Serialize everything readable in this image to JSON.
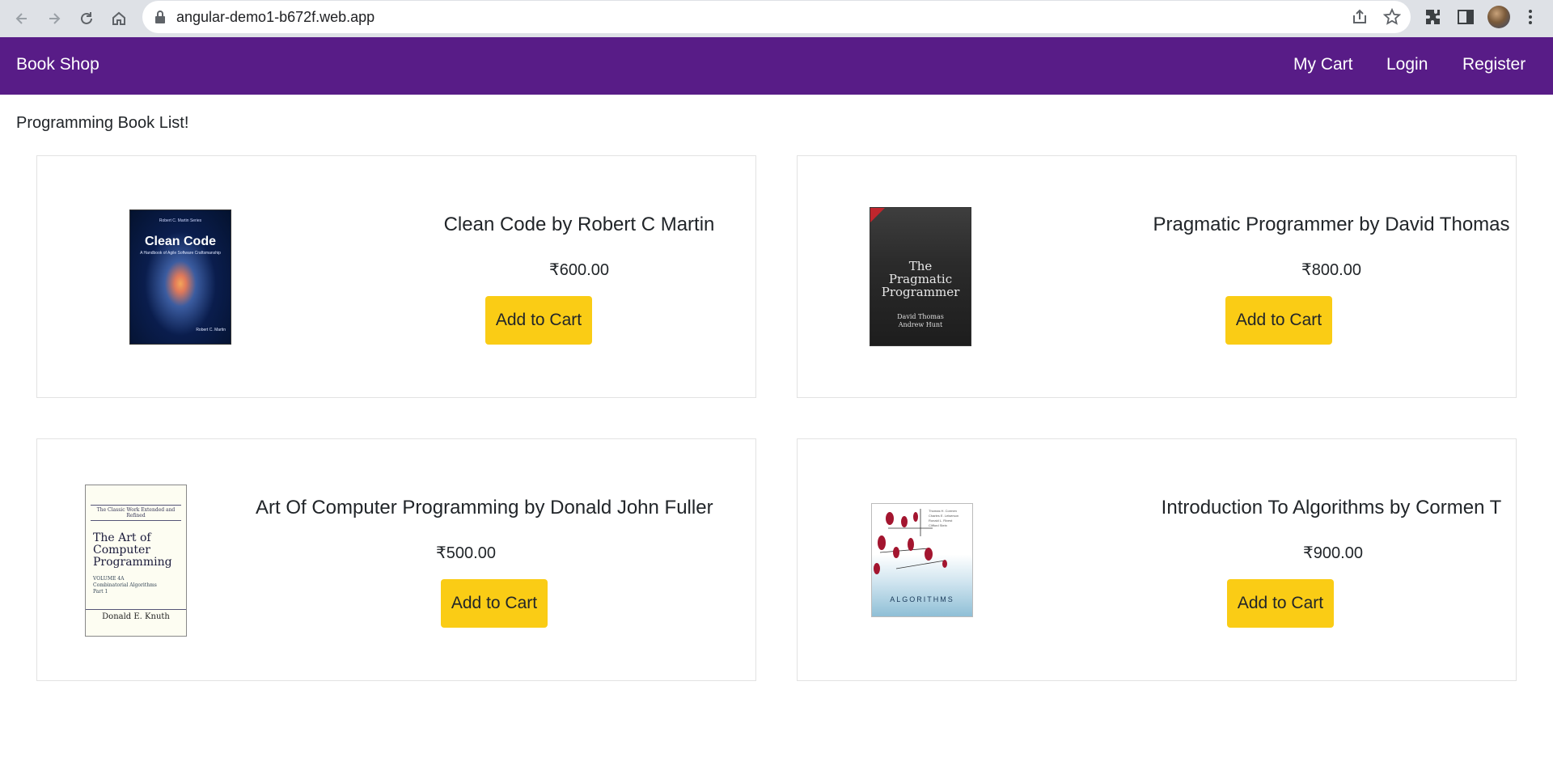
{
  "browser": {
    "url": "angular-demo1-b672f.web.app"
  },
  "navbar": {
    "brand": "Book Shop",
    "links": [
      "My Cart",
      "Login",
      "Register"
    ],
    "color": "#581c87"
  },
  "page": {
    "heading": "Programming Book List!"
  },
  "books": [
    {
      "title": "Clean Code by Robert C Martin",
      "price": "₹600.00",
      "button": "Add to Cart",
      "cover": {
        "series": "Robert C. Martin Series",
        "title": "Clean Code",
        "subtitle": "A Handbook of Agile Software Craftsmanship",
        "author": "Robert C. Martin"
      }
    },
    {
      "title": "Pragmatic Programmer by David Thomas",
      "price": "₹800.00",
      "button": "Add to Cart",
      "cover": {
        "title_line1": "The",
        "title_line2": "Pragmatic",
        "title_line3": "Programmer",
        "author_line1": "David Thomas",
        "author_line2": "Andrew Hunt"
      }
    },
    {
      "title": "Art Of Computer Programming by Donald John Fuller",
      "price": "₹500.00",
      "button": "Add to Cart",
      "cover": {
        "header": "The Classic Work Extended and Refined",
        "title_line1": "The Art of",
        "title_line2": "Computer",
        "title_line3": "Programming",
        "volume_line1": "VOLUME 4A",
        "volume_line2": "Combinatorial Algorithms",
        "volume_line3": "Part 1",
        "author": "Donald E. Knuth"
      }
    },
    {
      "title": "Introduction To Algorithms by Cormen T",
      "price": "₹900.00",
      "button": "Add to Cart",
      "cover": {
        "authors_line1": "Thomas H. Cormen",
        "authors_line2": "Charles E. Leiserson",
        "authors_line3": "Ronald L. Rivest",
        "authors_line4": "Clifford Stein",
        "title": "ALGORITHMS"
      }
    }
  ],
  "colors": {
    "button": "#facc15",
    "card_border": "#e2e2e2"
  }
}
